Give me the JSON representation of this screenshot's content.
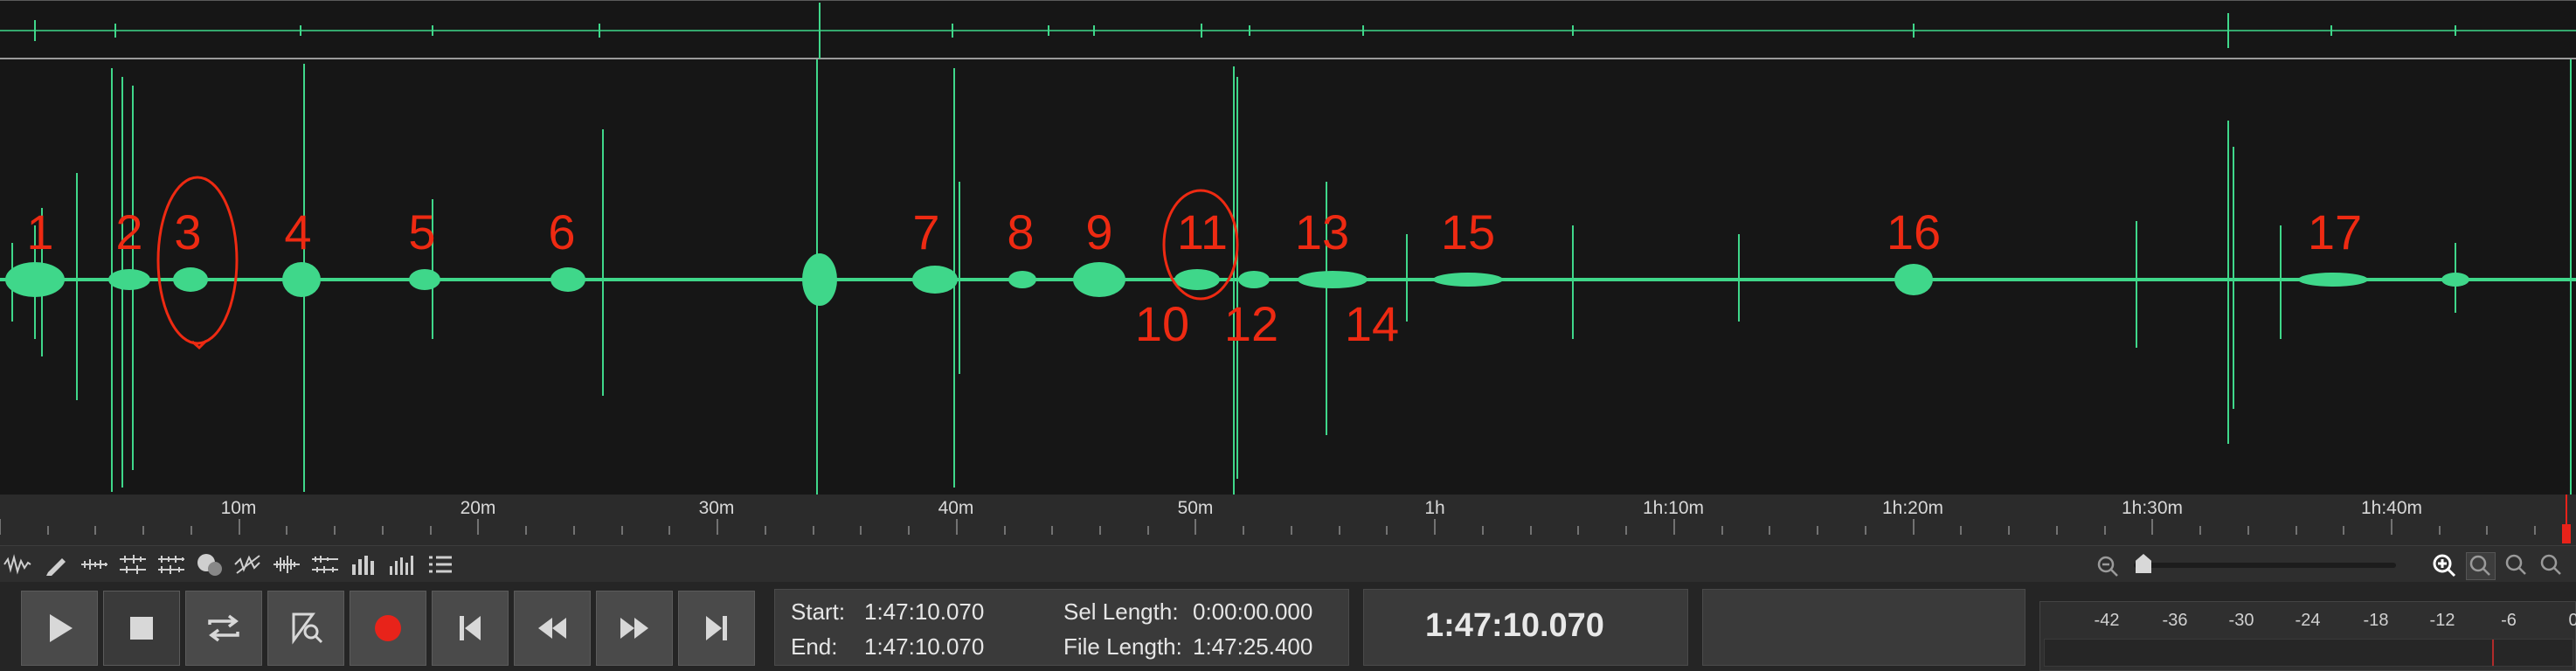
{
  "timeline": {
    "labels": [
      "10m",
      "20m",
      "30m",
      "40m",
      "50m",
      "1h",
      "1h:10m",
      "1h:20m",
      "1h:30m",
      "1h:40m"
    ]
  },
  "annotations": {
    "top_markers": [
      "1",
      "2",
      "3",
      "4",
      "5",
      "6",
      "7",
      "8",
      "9",
      "11",
      "13",
      "15",
      "16",
      "17"
    ],
    "bottom_markers": [
      "10",
      "12",
      "14"
    ],
    "circled": [
      "3",
      "11"
    ],
    "color": "#ee2a12"
  },
  "waveform": {
    "color": "#3fd78a"
  },
  "toolbar": {
    "tools": [
      "waveform-icon",
      "pencil-icon",
      "spectral-icon",
      "multitrack-icon",
      "loop-tool-icon",
      "help-icon",
      "silence-icon",
      "fade-icon",
      "normalize-icon",
      "level-bars-icon",
      "frequency-bars-icon",
      "list-icon"
    ],
    "zoom_tools": [
      "zoom-out-icon",
      "zoom-slider",
      "zoom-in-icon",
      "zoom-selection-icon",
      "zoom-fit-icon",
      "zoom-all-icon"
    ]
  },
  "transport": {
    "buttons": [
      "play",
      "stop",
      "loop",
      "scrub",
      "record",
      "skip-start",
      "rewind",
      "fast-forward",
      "skip-end"
    ]
  },
  "selection": {
    "start_label": "Start:",
    "start_value": "1:47:10.070",
    "end_label": "End:",
    "end_value": "1:47:10.070",
    "sel_length_label": "Sel Length:",
    "sel_length_value": "0:00:00.000",
    "file_length_label": "File Length:",
    "file_length_value": "1:47:25.400"
  },
  "position_display": "1:47:10.070",
  "meter": {
    "labels": [
      "-42",
      "-36",
      "-30",
      "-24",
      "-18",
      "-12",
      "-6",
      "0"
    ]
  }
}
